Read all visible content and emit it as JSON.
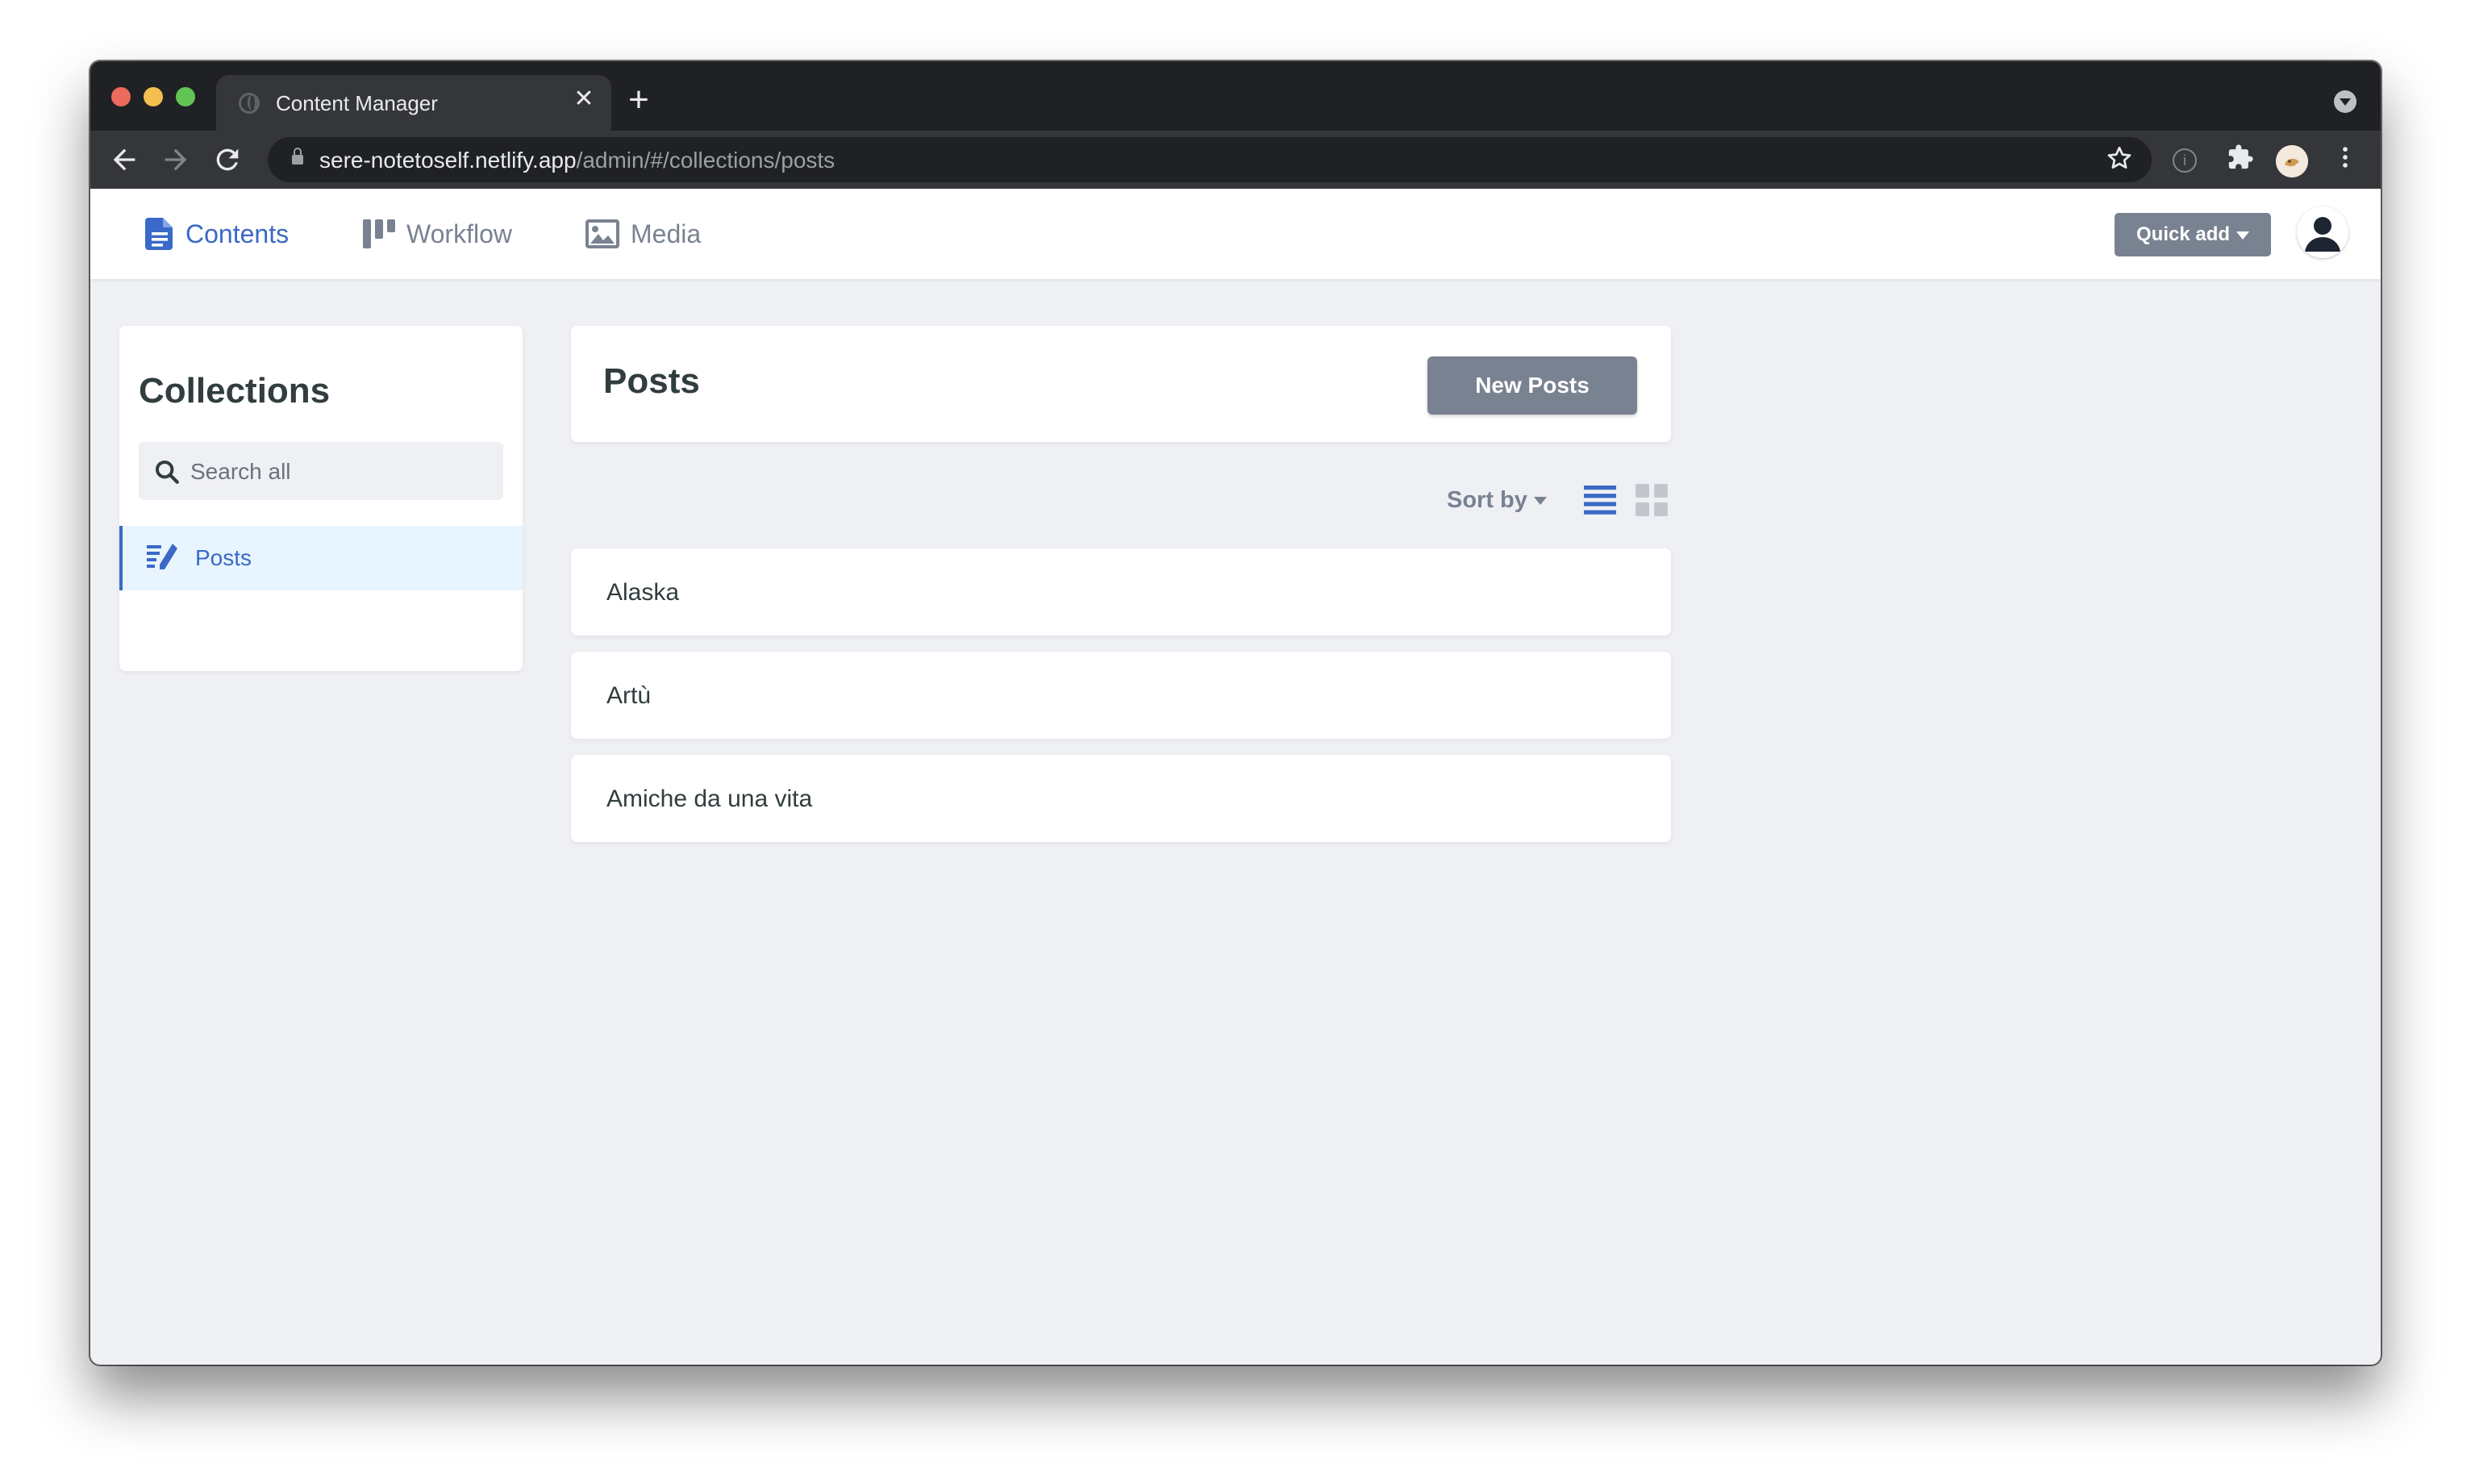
{
  "browser": {
    "tab_title": "Content Manager",
    "tab_close": "✕",
    "new_tab": "+",
    "url_host": "sere-notetoself.netlify.app",
    "url_path": "/admin/#/collections/posts"
  },
  "header": {
    "nav": [
      {
        "label": "Contents",
        "active": true
      },
      {
        "label": "Workflow",
        "active": false
      },
      {
        "label": "Media",
        "active": false
      }
    ],
    "quick_add": "Quick add"
  },
  "sidebar": {
    "title": "Collections",
    "search_placeholder": "Search all",
    "items": [
      {
        "label": "Posts",
        "active": true
      }
    ]
  },
  "main": {
    "title": "Posts",
    "new_button": "New Posts",
    "sort_label": "Sort by",
    "view_mode": "list",
    "entries": [
      {
        "title": "Alaska"
      },
      {
        "title": "Artù"
      },
      {
        "title": "Amiche da una vita"
      }
    ]
  },
  "colors": {
    "accent": "#3a69c7",
    "button": "#798291",
    "background": "#eff0f4"
  }
}
